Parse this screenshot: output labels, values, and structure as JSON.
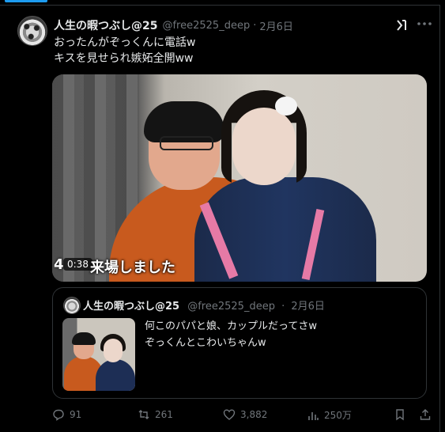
{
  "post": {
    "author_name": "人生の暇つぶし@25",
    "handle": "@free2525_deep",
    "separator": "·",
    "date": "2月6日",
    "grok_label": "x",
    "text_line1": "おったんがぞっくんに電話w",
    "text_line2": "キスを見せられ嫉妬全開ww",
    "video": {
      "duration_badge": "0:38",
      "caption_prefix": "4",
      "caption": "来場しました"
    }
  },
  "quote": {
    "author_name": "人生の暇つぶし@25",
    "handle": "@free2525_deep",
    "separator": "·",
    "date": "2月6日",
    "text_line1": "何このパパと娘、カップルだってさw",
    "text_line2": "ぞっくんとこわいちゃんw"
  },
  "actions": {
    "replies": "91",
    "reposts": "261",
    "likes": "3,882",
    "views": "250万"
  },
  "colors": {
    "background": "#000000",
    "text": "#e7e9ea",
    "muted": "#71767b",
    "border": "#2f3336",
    "accent": "#1d9bf0"
  }
}
